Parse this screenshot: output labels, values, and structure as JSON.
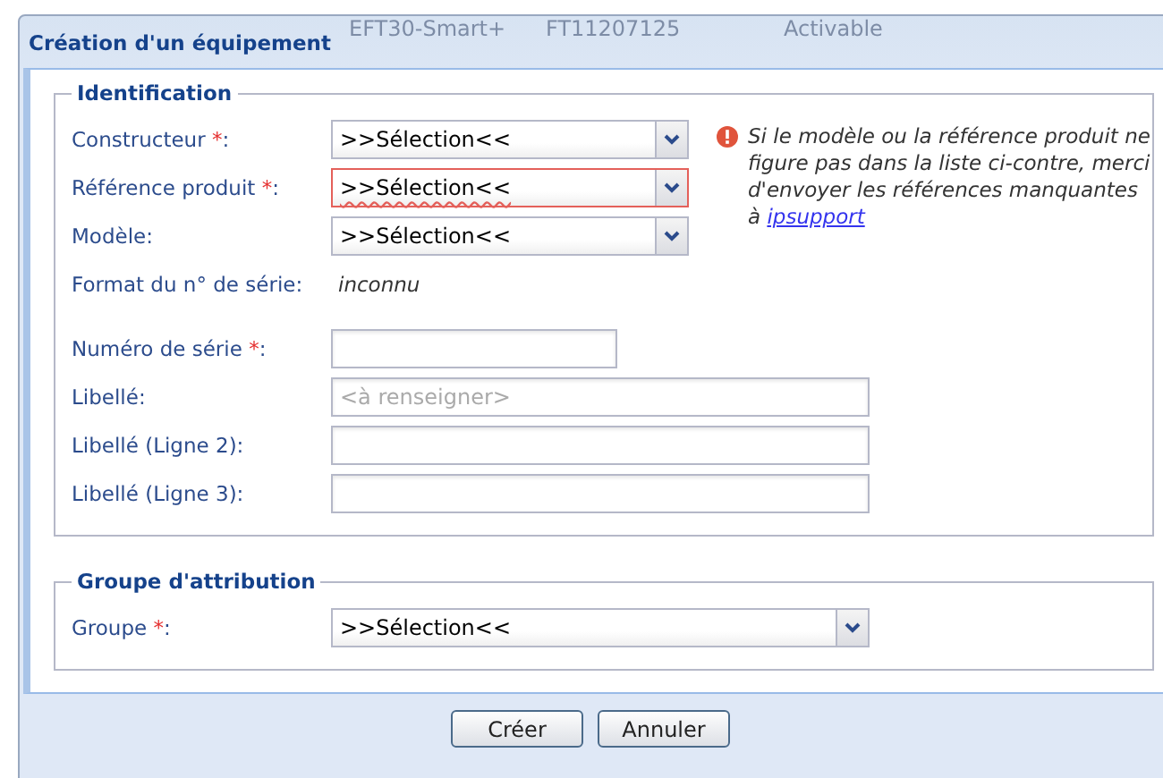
{
  "backdrop": {
    "texts": [
      "EFT30-Smart+",
      "FT11207125",
      "Activable"
    ]
  },
  "window": {
    "title": "Création d'un équipement"
  },
  "sections": [
    {
      "legend": "Identification",
      "notice": {
        "text": "Si le modèle ou la référence produit ne figure pas dans la liste ci-contre, merci d'envoyer les références manquantes à ",
        "link": "ipsupport"
      },
      "fields": [
        {
          "kind": "select",
          "label": "Constructeur ",
          "mark": "*",
          "end": ":",
          "value": ">>Sélection<<",
          "invalid": false
        },
        {
          "kind": "select",
          "label": "Référence produit ",
          "mark": "*",
          "end": ":",
          "value": ">>Sélection<<",
          "invalid": true
        },
        {
          "kind": "select",
          "label": "Modèle:",
          "value": ">>Sélection<<",
          "invalid": false
        },
        {
          "kind": "info",
          "label": "Format du n° de série:",
          "value": "inconnu"
        },
        {
          "kind": "input",
          "label": "Numéro de série ",
          "mark": "*",
          "end": ":"
        },
        {
          "kind": "input",
          "label": "Libellé:",
          "placeholder": "<à renseigner>"
        },
        {
          "kind": "input",
          "label": "Libellé (Ligne 2):"
        },
        {
          "kind": "input",
          "label": "Libellé (Ligne 3):"
        }
      ]
    },
    {
      "legend": "Groupe d'attribution",
      "fields": [
        {
          "kind": "select",
          "label": "Groupe ",
          "mark": "*",
          "end": ":",
          "value": ">>Sélection<<",
          "invalid": false
        }
      ]
    }
  ],
  "buttons": [
    "Créer",
    "Annuler"
  ]
}
